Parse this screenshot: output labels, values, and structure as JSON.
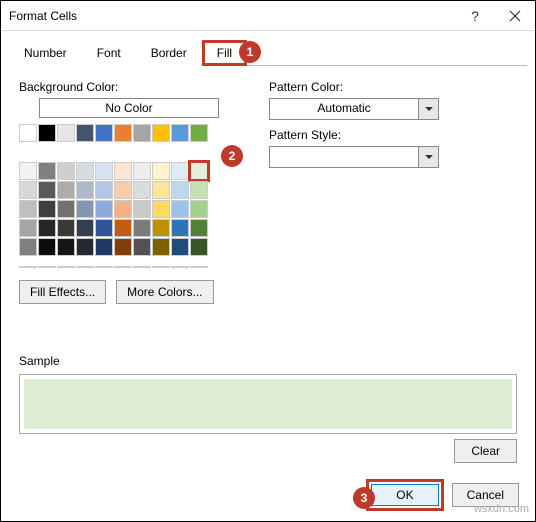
{
  "titlebar": {
    "title": "Format Cells"
  },
  "tabs": {
    "number": "Number",
    "font": "Font",
    "border": "Border",
    "fill": "Fill",
    "active": "Fill"
  },
  "labels": {
    "background_color": "Background Color:",
    "no_color": "No Color",
    "pattern_color": "Pattern Color:",
    "pattern_style": "Pattern Style:",
    "sample": "Sample"
  },
  "buttons": {
    "fill_effects": "Fill Effects...",
    "more_colors": "More Colors...",
    "clear": "Clear",
    "ok": "OK",
    "cancel": "Cancel"
  },
  "dropdowns": {
    "pattern_color_value": "Automatic",
    "pattern_style_value": ""
  },
  "callouts": {
    "c1": "1",
    "c2": "2",
    "c3": "3"
  },
  "colors": {
    "theme_row1": [
      "#ffffff",
      "#000000",
      "#e7e6e6",
      "#44546a",
      "#4472c4",
      "#ed7d31",
      "#a5a5a5",
      "#ffc000",
      "#5b9bd5",
      "#70ad47"
    ],
    "shades": [
      [
        "#f2f2f2",
        "#7f7f7f",
        "#d0cece",
        "#d6dce4",
        "#d9e2f3",
        "#fbe5d5",
        "#ededed",
        "#fff2cc",
        "#deebf6",
        "#e2efd9"
      ],
      [
        "#d8d8d8",
        "#595959",
        "#aeabab",
        "#adb9ca",
        "#b4c6e7",
        "#f7cbac",
        "#dbdbdb",
        "#fee599",
        "#bdd7ee",
        "#c5e0b3"
      ],
      [
        "#bfbfbf",
        "#3f3f3f",
        "#757070",
        "#8496b0",
        "#8eaadb",
        "#f4b183",
        "#c9c9c9",
        "#ffd965",
        "#9cc3e5",
        "#a8d08d"
      ],
      [
        "#a5a5a5",
        "#262626",
        "#3a3838",
        "#323f4f",
        "#2f5496",
        "#c55a11",
        "#7b7b7b",
        "#bf9000",
        "#2e75b5",
        "#538135"
      ],
      [
        "#7f7f7f",
        "#0c0c0c",
        "#171616",
        "#222a35",
        "#1f3864",
        "#833c0b",
        "#525252",
        "#7f6000",
        "#1e4e79",
        "#375623"
      ]
    ],
    "standard": [
      "#c00000",
      "#ff0000",
      "#ffc000",
      "#ffff00",
      "#92d050",
      "#00b050",
      "#00b0f0",
      "#0070c0",
      "#002060",
      "#7030a0"
    ],
    "selected": "#e2efd9",
    "sample": "#dfecd4"
  },
  "watermark": "wsxdn.com"
}
